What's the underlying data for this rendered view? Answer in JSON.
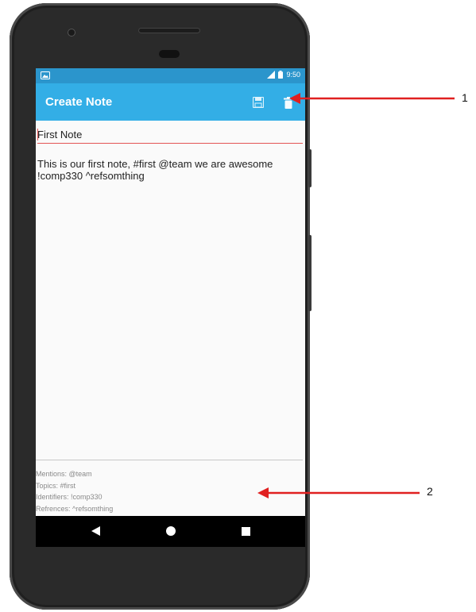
{
  "status_bar": {
    "time": "9:50"
  },
  "app_bar": {
    "title": "Create Note",
    "save_icon": "save-icon",
    "delete_icon": "delete-icon"
  },
  "note": {
    "title": "First Note",
    "body": "This is our first note, #first @team we are awesome !comp330 ^refsomthing"
  },
  "metadata": {
    "mentions": "Mentions: @team",
    "topics": "Topics: #first",
    "identifiers": "Identifiers: !comp330",
    "references": "Refrences: ^refsomthing"
  },
  "nav": {
    "back_icon": "back-icon",
    "home_icon": "home-icon",
    "recents_icon": "recents-icon"
  },
  "callouts": {
    "label_1": "1",
    "label_2": "2"
  },
  "colors": {
    "app_bar": "#33aee6",
    "status_bar": "#2b95cc",
    "accent": "#e35555",
    "arrow": "#e02020"
  }
}
